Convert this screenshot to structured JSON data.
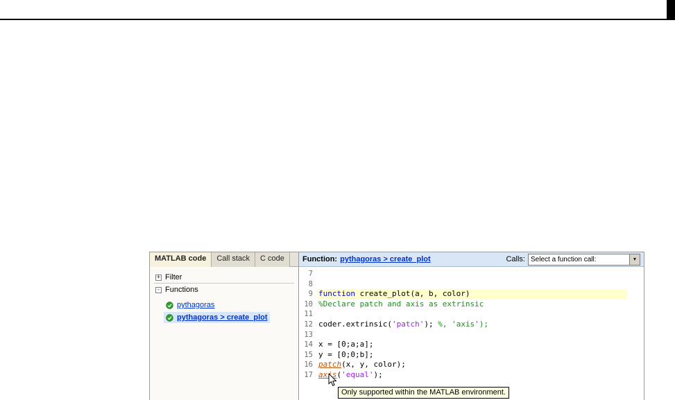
{
  "left_panel": {
    "tabs": [
      {
        "label": "MATLAB code",
        "active": true
      },
      {
        "label": "Call stack",
        "active": false
      },
      {
        "label": "C code",
        "active": false
      }
    ],
    "sections": {
      "filter": {
        "label": "Filter",
        "glyph": "+"
      },
      "functions": {
        "label": "Functions",
        "glyph": "-"
      }
    },
    "function_items": [
      {
        "label": "pythagoras",
        "selected": false
      },
      {
        "label": "pythagoras > create_plot",
        "selected": true
      }
    ]
  },
  "code_panel": {
    "header": {
      "function_label": "Function:",
      "function_link": "pythagoras > create_plot",
      "calls_label": "Calls:",
      "calls_value": "Select a function call:"
    },
    "lines": [
      {
        "num": "7",
        "segments": []
      },
      {
        "num": "8",
        "segments": []
      },
      {
        "num": "9",
        "highlight": true,
        "segments": [
          {
            "text": "function ",
            "style": "keyword"
          },
          {
            "text": "create_plot(a, b, color)",
            "style": "plain"
          }
        ]
      },
      {
        "num": "10",
        "segments": [
          {
            "text": "%Declare patch and axis as extrinsic",
            "style": "comment"
          }
        ]
      },
      {
        "num": "11",
        "segments": []
      },
      {
        "num": "12",
        "segments": [
          {
            "text": "coder.extrinsic(",
            "style": "plain"
          },
          {
            "text": "'patch'",
            "style": "string"
          },
          {
            "text": "); ",
            "style": "plain"
          },
          {
            "text": "%, 'axis');",
            "style": "comment"
          }
        ]
      },
      {
        "num": "13",
        "segments": []
      },
      {
        "num": "14",
        "segments": [
          {
            "text": "x = [0;a;a];",
            "style": "plain"
          }
        ]
      },
      {
        "num": "15",
        "segments": [
          {
            "text": "y = [0;0;b];",
            "style": "plain"
          }
        ]
      },
      {
        "num": "16",
        "segments": [
          {
            "text": "patch",
            "style": "extrinsic-link"
          },
          {
            "text": "(x, y, color);",
            "style": "plain"
          }
        ]
      },
      {
        "num": "17",
        "segments": [
          {
            "text": "axis",
            "style": "extrinsic-link"
          },
          {
            "text": "(",
            "style": "plain"
          },
          {
            "text": "'equal'",
            "style": "string"
          },
          {
            "text": ");",
            "style": "plain"
          }
        ]
      }
    ],
    "tooltip": "Only supported within the MATLAB environment."
  },
  "icons": {
    "dropdown_arrow": "▼"
  },
  "colors": {
    "keyword": "#0000ff",
    "comment": "#228b22",
    "string": "#a020f0",
    "extrinsic_link": "#c25608",
    "header_bg": "#d9e6f5",
    "highlight_line_bg": "#ffffcc",
    "link": "#0033cc",
    "tooltip_bg": "#ffffe1"
  }
}
